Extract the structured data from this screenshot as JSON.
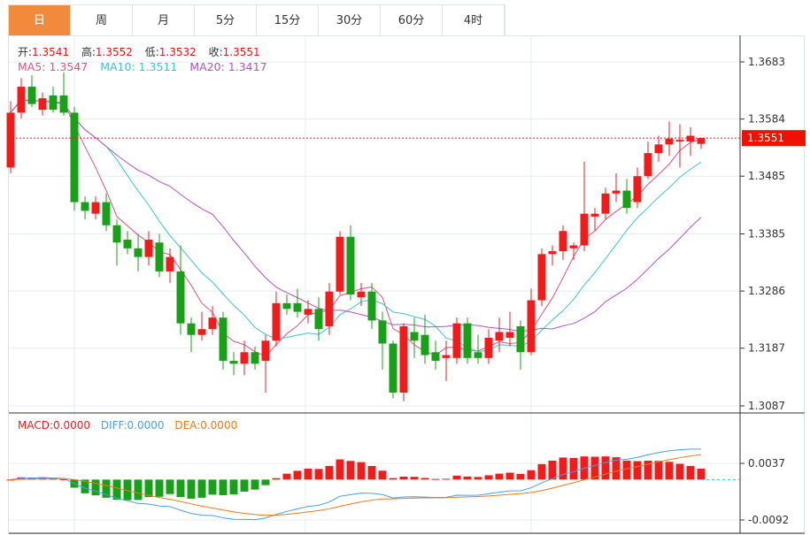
{
  "tabs": [
    "日",
    "周",
    "月",
    "5分",
    "15分",
    "30分",
    "60分",
    "4时"
  ],
  "active_tab": 0,
  "ohlc": {
    "open_label": "开:",
    "open": "1.3541",
    "high_label": "高:",
    "high": "1.3552",
    "low_label": "低:",
    "low": "1.3532",
    "close_label": "收:",
    "close": "1.3551"
  },
  "ma": {
    "ma5": "MA5: 1.3547",
    "ma10": "MA10: 1.3511",
    "ma20": "MA20: 1.3417"
  },
  "macd": {
    "macd": "MACD:0.0000",
    "diff": "DIFF:0.0000",
    "dea": "DEA:0.0000"
  },
  "colors": {
    "up": "#f01c1c",
    "down": "#18a018",
    "ma5": "#e8507a",
    "ma10": "#3cc3d8",
    "ma20": "#b450c8",
    "diff": "#4a9ee8",
    "dea": "#f07818",
    "accent": "#f28a3c"
  },
  "chart_data": {
    "type": "candlestick",
    "price_ticks": [
      "1.3683",
      "1.3584",
      "1.3485",
      "1.3385",
      "1.3286",
      "1.3187",
      "1.3087"
    ],
    "price_range": [
      1.3087,
      1.3683
    ],
    "last_price": "1.3551",
    "macd_ticks": [
      "0.0037",
      "-0.0092"
    ],
    "macd_range": [
      -0.0092,
      0.0037
    ],
    "candles": [
      [
        1.35,
        1.3615,
        1.349,
        1.3595
      ],
      [
        1.3595,
        1.3655,
        1.3585,
        1.364
      ],
      [
        1.364,
        1.366,
        1.3605,
        1.361
      ],
      [
        1.36,
        1.363,
        1.359,
        1.362
      ],
      [
        1.3625,
        1.364,
        1.3595,
        1.36
      ],
      [
        1.3625,
        1.3665,
        1.359,
        1.3595
      ],
      [
        1.3595,
        1.3605,
        1.3425,
        1.344
      ],
      [
        1.344,
        1.345,
        1.341,
        1.3425
      ],
      [
        1.342,
        1.345,
        1.341,
        1.344
      ],
      [
        1.344,
        1.3455,
        1.339,
        1.34
      ],
      [
        1.34,
        1.341,
        1.333,
        1.337
      ],
      [
        1.3375,
        1.339,
        1.335,
        1.336
      ],
      [
        1.336,
        1.3385,
        1.332,
        1.3345
      ],
      [
        1.3345,
        1.339,
        1.333,
        1.3375
      ],
      [
        1.337,
        1.3385,
        1.331,
        1.332
      ],
      [
        1.332,
        1.336,
        1.33,
        1.3345
      ],
      [
        1.332,
        1.3365,
        1.321,
        1.323
      ],
      [
        1.323,
        1.324,
        1.318,
        1.321
      ],
      [
        1.321,
        1.325,
        1.32,
        1.322
      ],
      [
        1.322,
        1.326,
        1.321,
        1.324
      ],
      [
        1.324,
        1.325,
        1.315,
        1.3165
      ],
      [
        1.3165,
        1.318,
        1.314,
        1.316
      ],
      [
        1.316,
        1.32,
        1.314,
        1.318
      ],
      [
        1.318,
        1.319,
        1.315,
        1.316
      ],
      [
        1.3165,
        1.321,
        1.311,
        1.32
      ],
      [
        1.32,
        1.3285,
        1.319,
        1.3265
      ],
      [
        1.3265,
        1.328,
        1.3245,
        1.3255
      ],
      [
        1.3265,
        1.329,
        1.324,
        1.325
      ],
      [
        1.3245,
        1.327,
        1.323,
        1.3255
      ],
      [
        1.3255,
        1.3275,
        1.32,
        1.322
      ],
      [
        1.3225,
        1.33,
        1.321,
        1.3285
      ],
      [
        1.3285,
        1.339,
        1.328,
        1.338
      ],
      [
        1.338,
        1.34,
        1.327,
        1.328
      ],
      [
        1.3275,
        1.33,
        1.326,
        1.3285
      ],
      [
        1.3285,
        1.33,
        1.322,
        1.3235
      ],
      [
        1.3235,
        1.325,
        1.315,
        1.3195
      ],
      [
        1.3195,
        1.32,
        1.31,
        1.311
      ],
      [
        1.311,
        1.323,
        1.3095,
        1.3225
      ],
      [
        1.3215,
        1.324,
        1.317,
        1.32
      ],
      [
        1.321,
        1.3245,
        1.316,
        1.3175
      ],
      [
        1.318,
        1.32,
        1.315,
        1.3165
      ],
      [
        1.317,
        1.32,
        1.313,
        1.3175
      ],
      [
        1.317,
        1.324,
        1.316,
        1.323
      ],
      [
        1.323,
        1.324,
        1.316,
        1.317
      ],
      [
        1.318,
        1.321,
        1.316,
        1.317
      ],
      [
        1.317,
        1.322,
        1.316,
        1.3205
      ],
      [
        1.32,
        1.324,
        1.318,
        1.3215
      ],
      [
        1.3205,
        1.325,
        1.319,
        1.3215
      ],
      [
        1.3225,
        1.3235,
        1.315,
        1.318
      ],
      [
        1.318,
        1.329,
        1.3175,
        1.327
      ],
      [
        1.327,
        1.336,
        1.326,
        1.335
      ],
      [
        1.335,
        1.3365,
        1.333,
        1.3355
      ],
      [
        1.3355,
        1.34,
        1.334,
        1.339
      ],
      [
        1.336,
        1.337,
        1.334,
        1.3365
      ],
      [
        1.3365,
        1.351,
        1.3355,
        1.342
      ],
      [
        1.3415,
        1.343,
        1.339,
        1.342
      ],
      [
        1.342,
        1.3465,
        1.341,
        1.3455
      ],
      [
        1.3455,
        1.349,
        1.344,
        1.346
      ],
      [
        1.346,
        1.348,
        1.342,
        1.343
      ],
      [
        1.344,
        1.35,
        1.343,
        1.3485
      ],
      [
        1.3485,
        1.3545,
        1.348,
        1.3525
      ],
      [
        1.3525,
        1.3555,
        1.351,
        1.354
      ],
      [
        1.354,
        1.358,
        1.352,
        1.355
      ],
      [
        1.3545,
        1.3575,
        1.35,
        1.3548
      ],
      [
        1.3545,
        1.357,
        1.352,
        1.3555
      ],
      [
        1.3541,
        1.3552,
        1.3532,
        1.3551
      ]
    ]
  }
}
